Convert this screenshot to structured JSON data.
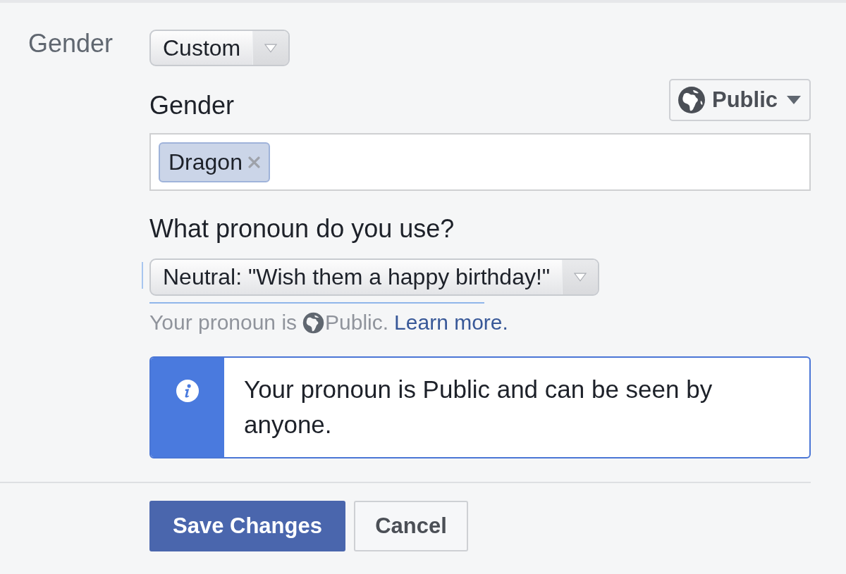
{
  "field_label": "Gender",
  "gender_select": {
    "value": "Custom"
  },
  "custom_gender": {
    "label": "Gender",
    "audience": "Public",
    "tokens": [
      {
        "label": "Dragon"
      }
    ]
  },
  "pronoun": {
    "label": "What pronoun do you use?",
    "select_value": "Neutral: \"Wish them a happy birthday!\"",
    "note": {
      "prefix": "Your pronoun is",
      "audience": "Public.",
      "link": "Learn more."
    }
  },
  "info_box": {
    "text": "Your pronoun is Public and can be seen by anyone."
  },
  "buttons": [
    {
      "label": "Save Changes",
      "kind": "primary"
    },
    {
      "label": "Cancel",
      "kind": "secondary"
    }
  ]
}
